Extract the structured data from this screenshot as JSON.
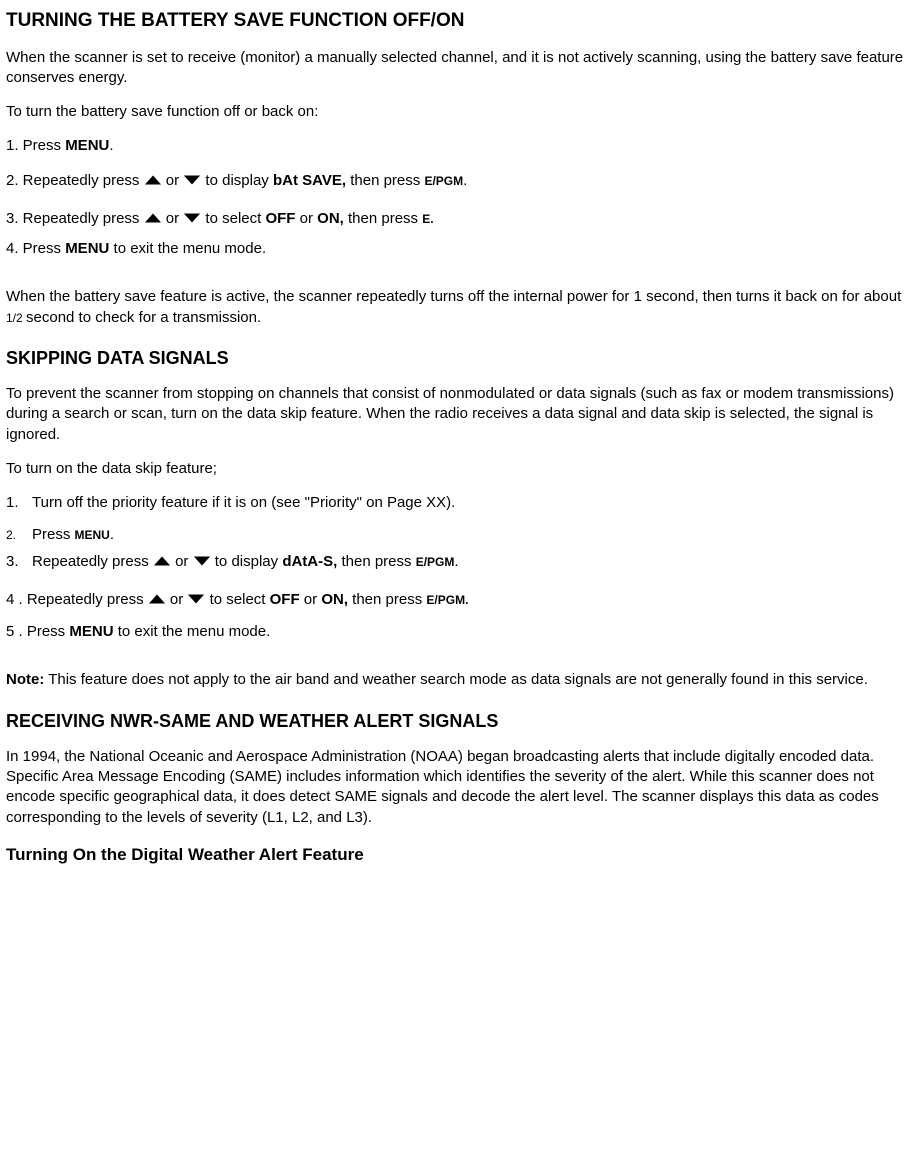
{
  "sec1": {
    "title": "TURNING THE BATTERY SAVE FUNCTION OFF/ON",
    "intro": "When the scanner is set to receive (monitor) a manually selected channel, and it is not actively scanning, using the battery save feature conserves energy.",
    "toTurn": "To turn the battery save function off or back on:",
    "s1a": "1. Press ",
    "s1b": "MENU",
    "s1c": ".",
    "s2a": "2. Repeatedly press  ",
    "s2b": " or  ",
    "s2c": "  to display ",
    "s2d": "bAt SAVE,",
    "s2e": " then press ",
    "s2f": "E/PGM",
    "s2g": ".",
    "s3a": "3. Repeatedly press  ",
    "s3b": " or  ",
    "s3c": "  to select ",
    "s3d": "OFF",
    "s3e": " or ",
    "s3f": "ON,",
    "s3g": " then press ",
    "s3h": "E.",
    "s4a": "4. Press ",
    "s4b": "MENU",
    "s4c": " to exit the menu mode.",
    "outroA": "When the battery save feature is active, the scanner repeatedly turns off the internal power for 1 second, then turns it back on for about ",
    "outroHalf": "1/2 ",
    "outroB": "second to check for a transmission."
  },
  "sec2": {
    "title": "SKIPPING DATA SIGNALS",
    "intro": "To prevent the scanner from stopping on channels that consist of nonmodulated or data signals (such as fax or modem transmissions) during a search or scan, turn on the data skip feature. When the radio receives a data signal and data skip is selected, the signal is ignored.",
    "toTurn": "To turn on the data skip feature;",
    "s1n": "1.",
    "s1t": "Turn off the priority feature if it is on (see \"Priority\" on Page XX).",
    "s2n": "2.",
    "s2a": "Press ",
    "s2b": "MENU",
    "s2c": ".",
    "s3n": "3.",
    "s3a": "Repeatedly press  ",
    "s3b": " or  ",
    "s3c": "  to display ",
    "s3d": "dAtA-S,",
    "s3e": " then press ",
    "s3f": "E/PGM",
    "s3g": ".",
    "s4a": "4 . Repeatedly press  ",
    "s4b": " or  ",
    "s4c": "  to select ",
    "s4d": "OFF",
    "s4e": " or ",
    "s4f": "ON,",
    "s4g": " then press ",
    "s4h": "E/PGM.",
    "s5a": "5 . Press ",
    "s5b": "MENU",
    "s5c": " to exit the menu mode.",
    "noteLabel": "Note:",
    "noteText": " This feature does not apply to the air band and weather search mode as data signals are not generally found in this service."
  },
  "sec3": {
    "title": "RECEIVING NWR-SAME AND WEATHER ALERT SIGNALS",
    "body": "In 1994, the National Oceanic and Aerospace Administration (NOAA) began broadcasting alerts that include digitally encoded data. Specific Area Message Encoding (SAME) includes information which identifies the severity of the alert. While this scanner does not encode specific geographical data, it does detect SAME signals and decode the alert level. The scanner displays this data as codes corresponding to the levels of severity (L1, L2, and L3).",
    "sub": "Turning On the Digital Weather Alert Feature"
  }
}
